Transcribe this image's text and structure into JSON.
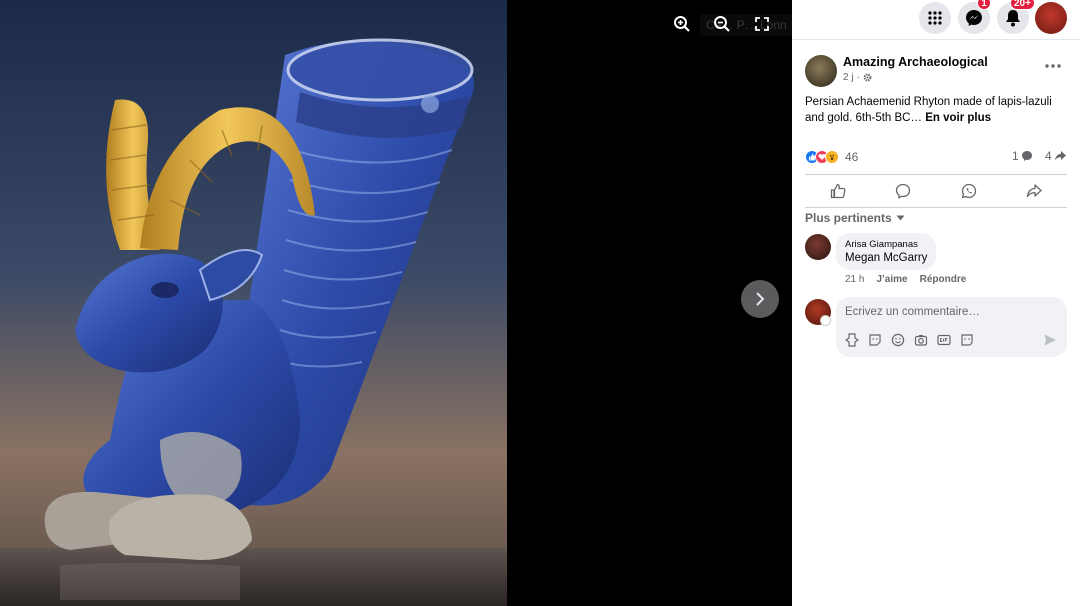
{
  "viewer": {
    "search_ghost": "Ce… P… Lonn"
  },
  "header": {
    "messenger_badge": "1",
    "notifications_badge": "20+"
  },
  "post": {
    "author": "Amazing Archaeological",
    "time": "2 j",
    "privacy": "·",
    "text": "Persian Achaemenid Rhyton made of lapis-lazuli and gold. 6th-5th BC…",
    "see_more": "En voir plus",
    "reaction_count": "46",
    "comment_count": "1",
    "share_count": "4"
  },
  "comments": {
    "sort_label": "Plus pertinents",
    "items": [
      {
        "author": "Arisa Giampanas",
        "text": "Megan McGarry",
        "time": "21 h",
        "like": "J’aime",
        "reply": "Répondre"
      }
    ],
    "composer_placeholder": "Écrivez un commentaire…"
  },
  "colors": {
    "brand_blue": "#1877f2",
    "badge_red": "#e41e3f",
    "lapis": "#2c4aa8",
    "gold": "#d9a93a"
  }
}
